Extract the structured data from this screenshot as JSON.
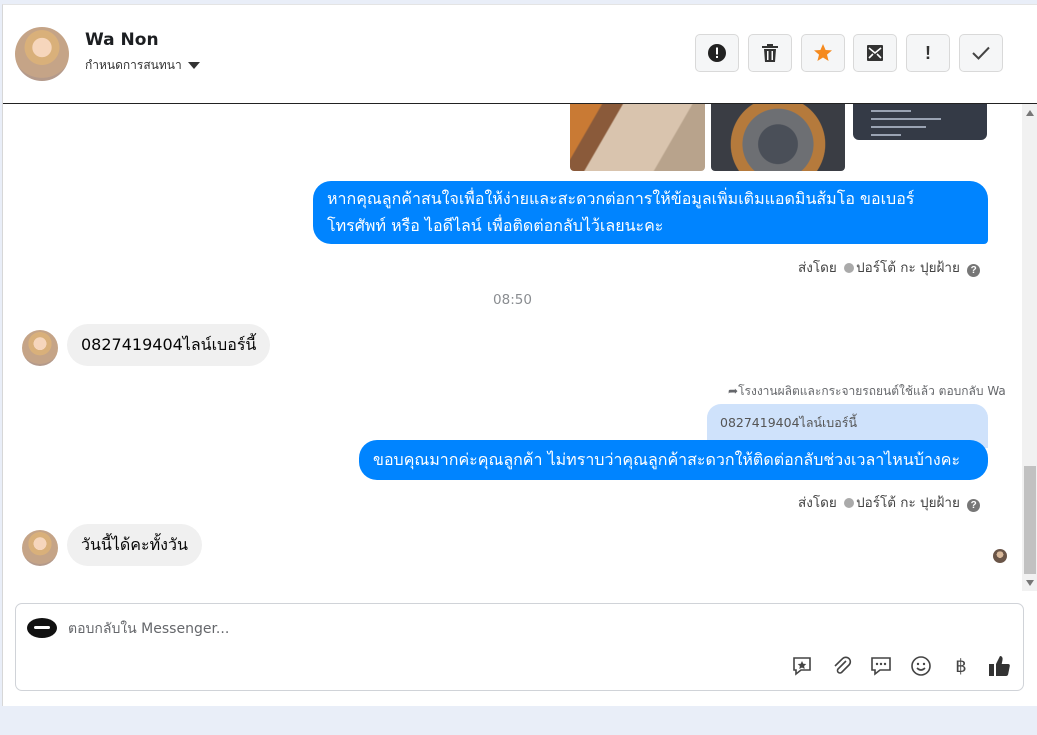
{
  "header": {
    "contact_name": "Wa Non",
    "assign_label": "กำหนดการสนทนา",
    "toolbar_icons": [
      "alert-circle-icon",
      "trash-icon",
      "star-icon",
      "mail-archive-icon",
      "exclamation-icon",
      "check-icon"
    ],
    "excl_glyph": "!"
  },
  "messages": {
    "outgoing_1": {
      "line1": "หากคุณลูกค้าสนใจเพื่อให้ง่ายและสะดวกต่อการให้ข้อมูลเพิ่มเติมแอดมินส้มโอ ขอเบอร์",
      "line2": "โทรศัพท์ หรือ ไอดีไลน์ เพื่อติดต่อกลับไว้เลยนะคะ"
    },
    "sent_by_1": {
      "prefix": "ส่งโดย",
      "sender": "ปอร์โต้ กะ ปุยฝ้าย"
    },
    "timestamp": "08:50",
    "incoming_1": "0827419404ไลน์เบอร์นี้",
    "reply_hint": "โรงงานผลิตและกระจายรถยนต์ใช้แล้ว ตอบกลับ Wa",
    "quoted_text": "0827419404ไลน์เบอร์นี้",
    "outgoing_2": "ขอบคุณมากค่ะคุณลูกค้า ไม่ทราบว่าคุณลูกค้าสะดวกให้ติดต่อกลับช่วงเวลาไหนบ้างคะ",
    "sent_by_2": {
      "prefix": "ส่งโดย",
      "sender": "ปอร์โต้ กะ ปุยฝ้าย"
    },
    "incoming_2": "วันนี้ได้คะทั้งวัน",
    "help_glyph": "?"
  },
  "composer": {
    "placeholder": "ตอบกลับใน Messenger...",
    "baht_glyph": "฿",
    "icons": [
      "saved-reply-icon",
      "attachment-icon",
      "chat-bubble-icon",
      "emoji-icon",
      "baht-icon",
      "like-icon"
    ]
  },
  "colors": {
    "accent": "#0084ff",
    "quote_bg": "#cfe2fb",
    "incoming_bg": "#f0f0f0"
  }
}
